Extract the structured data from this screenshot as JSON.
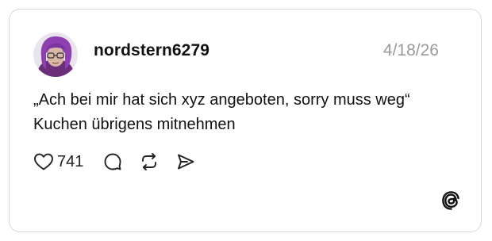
{
  "post": {
    "username": "nordstern6279",
    "date": "4/18/26",
    "text": "„Ach bei mir hat sich xyz angeboten, sorry muss weg“ Kuchen übrigens mitnehmen",
    "likes": "741"
  },
  "icons": {
    "like": "heart-icon",
    "reply": "comment-bubble-icon",
    "repost": "repost-icon",
    "share": "send-icon",
    "brand": "threads-logo-icon"
  },
  "colors": {
    "text": "#111111",
    "muted": "#9a9a9a",
    "border": "#d6d6d6"
  }
}
